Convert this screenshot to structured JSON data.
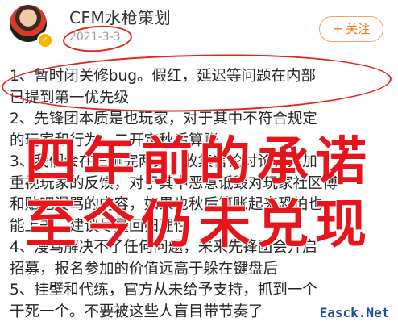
{
  "post": {
    "username": "CFM水枪策划",
    "date": "2021-3-3",
    "follow_label": "关注",
    "follow_icon": "plus-icon"
  },
  "content": {
    "lines": [
      "1、暂时闭关修bug。假红，延迟等问题在内部",
      "已提到第一优先级",
      "2、先锋团本质是也玩家，对于其中不符合规定",
      "的玩家和行为，二开定秋后算账",
      "3、我们会在三测完两天，收集言论讨论，并加",
      "重视玩家的反馈，对于其中恶意诋毁对玩家社区博",
      "和贴吧漫骂的内容，如果也秋后算账起来恐怕也",
      "能上去，建议尽量回归理性",
      "4、漫骂解决不了任何问题，未来先锋团会开启",
      "招募，报名参加的价值远高于躲在键盘后",
      "5、挂壁和代练，官方从未给予支持，抓到一个",
      "干死一个。不要被这些人盲目带节奏了"
    ]
  },
  "overlay": {
    "line1": "四年前的承诺",
    "line2": "至今仍未兑现"
  },
  "watermark": "Easck.Net",
  "colors": {
    "overlay_red": "#e8141c",
    "circle_red": "#e0251b",
    "follow_orange": "#f07a1a",
    "watermark_blue": "#1f4f9e"
  }
}
